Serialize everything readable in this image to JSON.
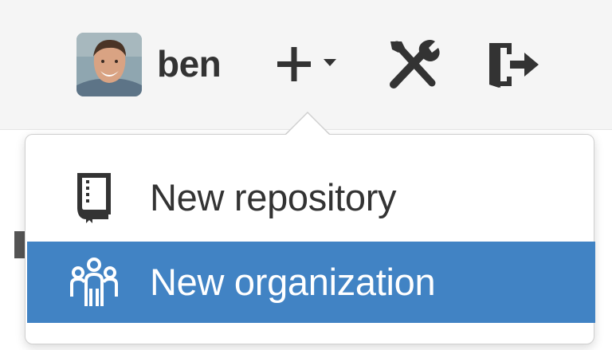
{
  "header": {
    "username": "ben",
    "avatar_icon": "user-avatar",
    "create_icon": "plus-icon",
    "create_dropdown_icon": "caret-down-icon",
    "settings_icon": "tools-icon",
    "signout_icon": "sign-out-icon"
  },
  "dropdown": {
    "items": [
      {
        "label": "New repository",
        "icon": "repo-icon",
        "highlighted": false
      },
      {
        "label": "New organization",
        "icon": "organization-icon",
        "highlighted": true
      }
    ]
  },
  "colors": {
    "highlight": "#4183c4",
    "text": "#333333",
    "header_bg": "#f5f5f5"
  }
}
